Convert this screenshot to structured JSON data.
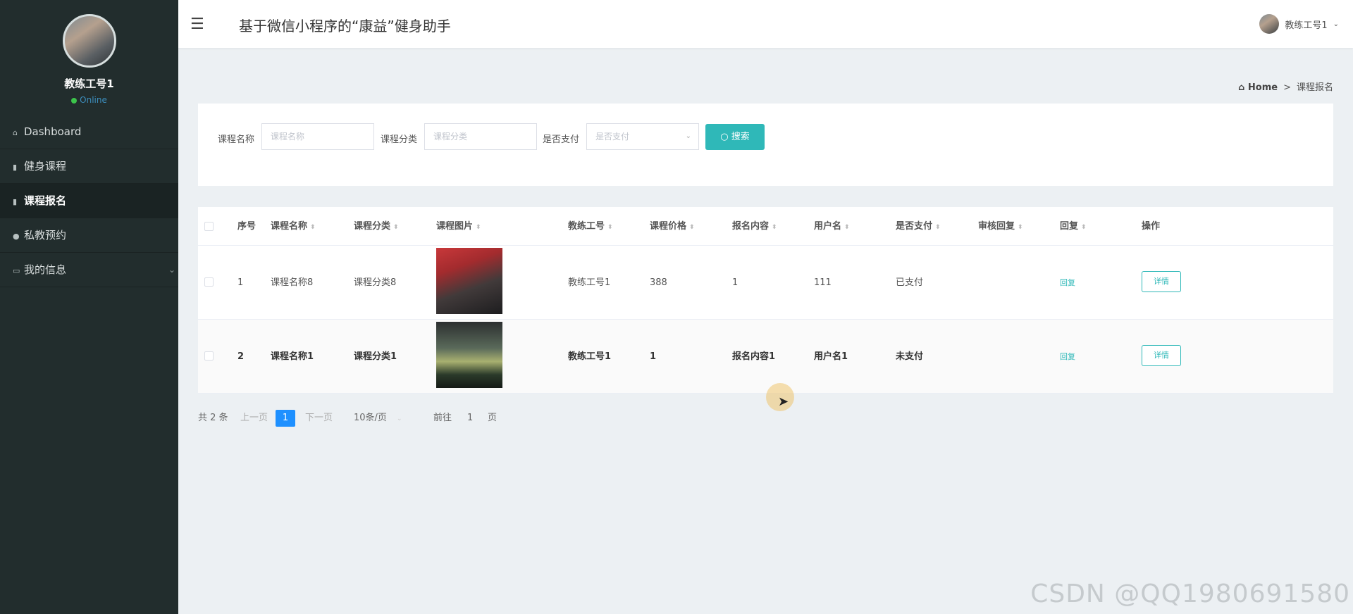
{
  "sidebar": {
    "user_name": "教练工号1",
    "status": "Online",
    "items": [
      {
        "icon": "home-icon",
        "label": "Dashboard"
      },
      {
        "icon": "clipboard-icon",
        "label": "健身课程"
      },
      {
        "icon": "file-icon",
        "label": "课程报名"
      },
      {
        "icon": "location-pin-icon",
        "label": "私教预约"
      },
      {
        "icon": "id-card-icon",
        "label": "我的信息"
      }
    ]
  },
  "header": {
    "title": "基于微信小程序的“康益”健身助手",
    "user_name": "教练工号1"
  },
  "breadcrumb": {
    "home": "Home",
    "current": "课程报名"
  },
  "search": {
    "course_name_label": "课程名称",
    "course_name_placeholder": "课程名称",
    "course_category_label": "课程分类",
    "course_category_placeholder": "课程分类",
    "paid_label": "是否支付",
    "paid_placeholder": "是否支付",
    "search_button": "搜索"
  },
  "table": {
    "headers": [
      "序号",
      "课程名称",
      "课程分类",
      "课程图片",
      "教练工号",
      "课程价格",
      "报名内容",
      "用户名",
      "是否支付",
      "审核回复",
      "回复",
      "操作"
    ],
    "rows": [
      {
        "index": "1",
        "course_name": "课程名称8",
        "category": "课程分类8",
        "coach": "教练工号1",
        "price": "388",
        "content": "1",
        "username": "111",
        "paid": "已支付",
        "review": "",
        "reply": "回复",
        "action": "详情"
      },
      {
        "index": "2",
        "course_name": "课程名称1",
        "category": "课程分类1",
        "coach": "教练工号1",
        "price": "1",
        "content": "报名内容1",
        "username": "用户名1",
        "paid": "未支付",
        "review": "",
        "reply": "回复",
        "action": "详情"
      }
    ]
  },
  "pagination": {
    "total": "共 2 条",
    "prev": "上一页",
    "current": "1",
    "next": "下一页",
    "page_size": "10条/页",
    "goto_label": "前往",
    "goto_value": "1",
    "page_unit": "页"
  },
  "watermark": "CSDN @QQ1980691580",
  "colors": {
    "sidebar_bg": "#222d2d",
    "accent": "#2fb8b8",
    "page_active": "#1e90ff"
  }
}
